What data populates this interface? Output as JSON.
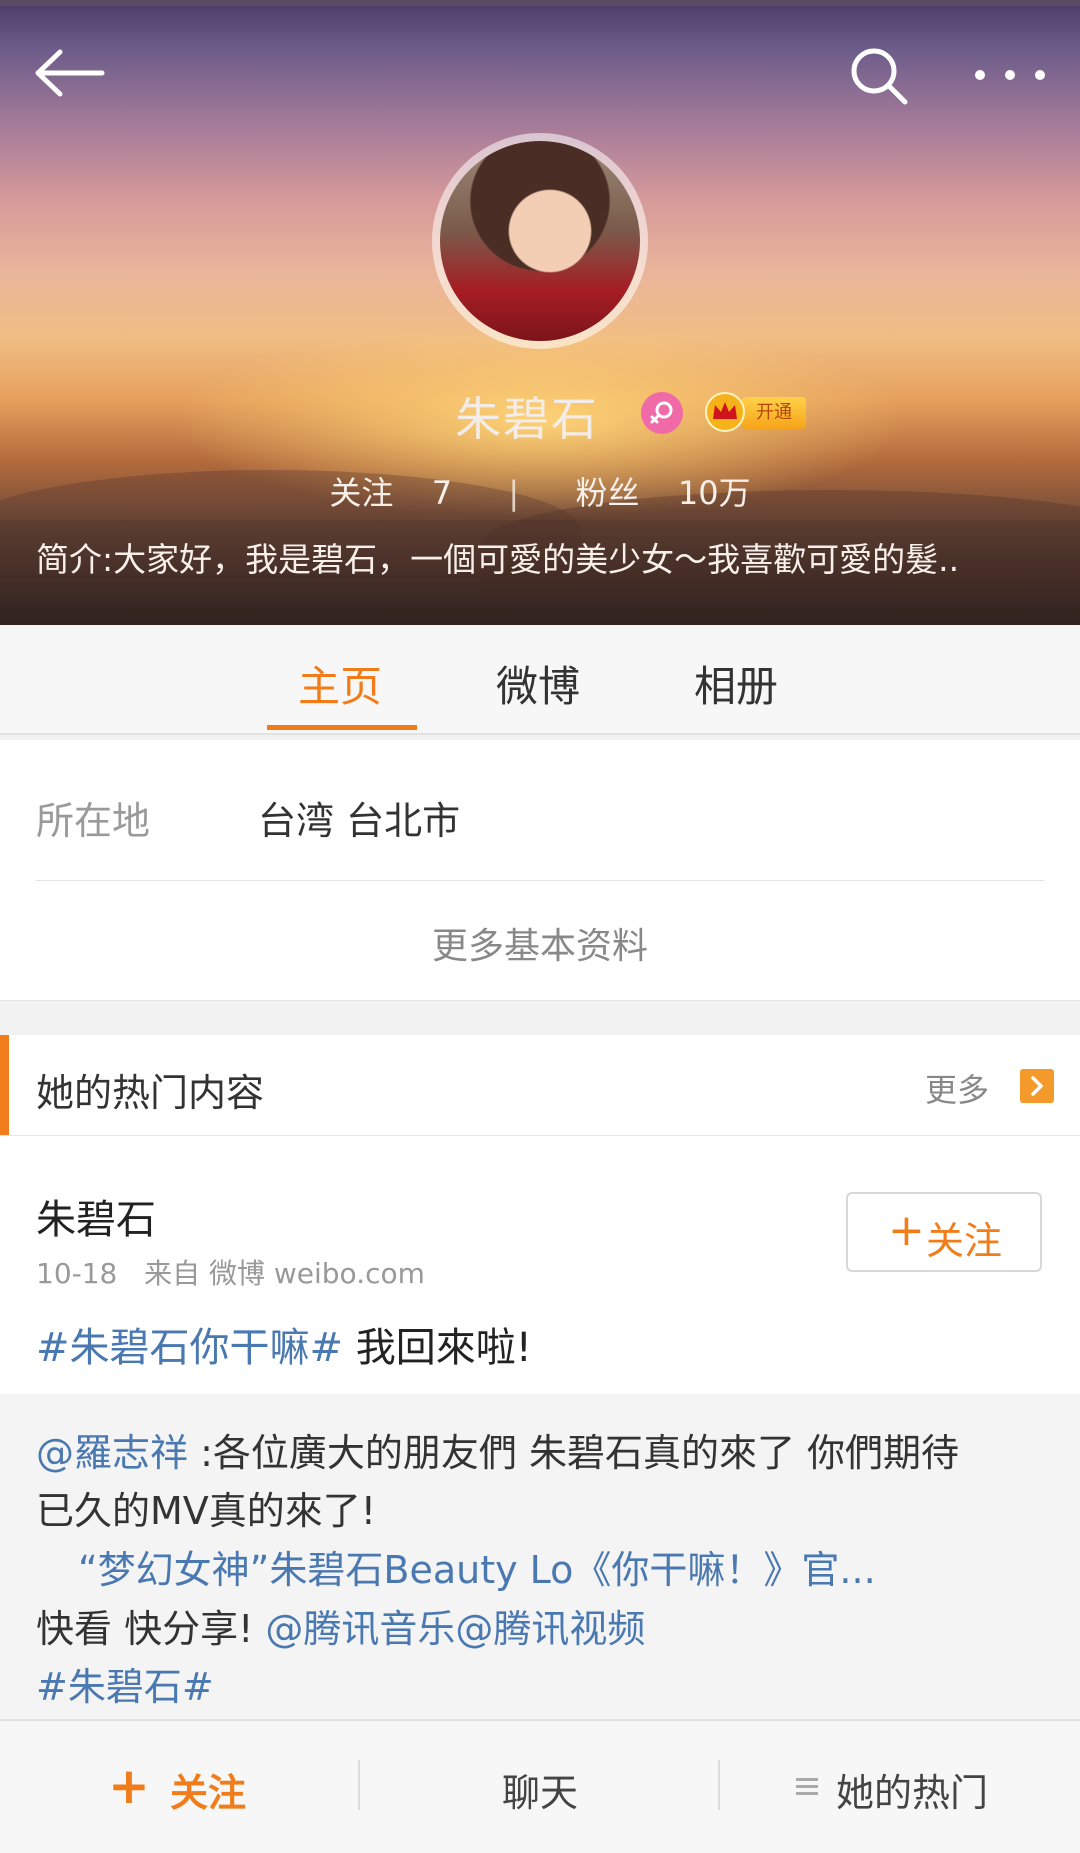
{
  "header": {
    "user_name": "朱碧石",
    "vip_label": "开通",
    "following_label": "关注",
    "following_count": "7",
    "stats_separator": "|",
    "followers_label": "粉丝",
    "followers_count": "10万",
    "intro": "简介:大家好，我是碧石，一個可愛的美少女～我喜歡可愛的髮.."
  },
  "tabs": [
    "主页",
    "微博",
    "相册"
  ],
  "info": {
    "location_label": "所在地",
    "location_value": "台湾 台北市",
    "more_info": "更多基本资料"
  },
  "hot": {
    "title": "她的热门内容",
    "more": "更多"
  },
  "post": {
    "author": "朱碧石",
    "date": "10-18",
    "source": "来自 微博 weibo.com",
    "follow_plus": "+",
    "follow_label": "关注",
    "tag": "#朱碧石你干嘛#",
    "text": " 我回來啦!"
  },
  "repost": {
    "mention": "@羅志祥",
    "line1_text": " :各位廣大的朋友們 朱碧石真的來了 你們期待",
    "line2": "已久的MV真的來了!",
    "video_link": "“梦幻女神”朱碧石Beauty Lo《你干嘛！》官...",
    "line4_text": "快看 快分享!",
    "mentions2": "@腾讯音乐@腾讯视频",
    "tag": "#朱碧石#"
  },
  "bottom_bar": {
    "follow_plus": "+",
    "follow_label": "关注",
    "chat_label": "聊天",
    "hot_label": "她的热门"
  },
  "colors": {
    "accent": "#f07d1a",
    "link": "#4a78b0"
  }
}
